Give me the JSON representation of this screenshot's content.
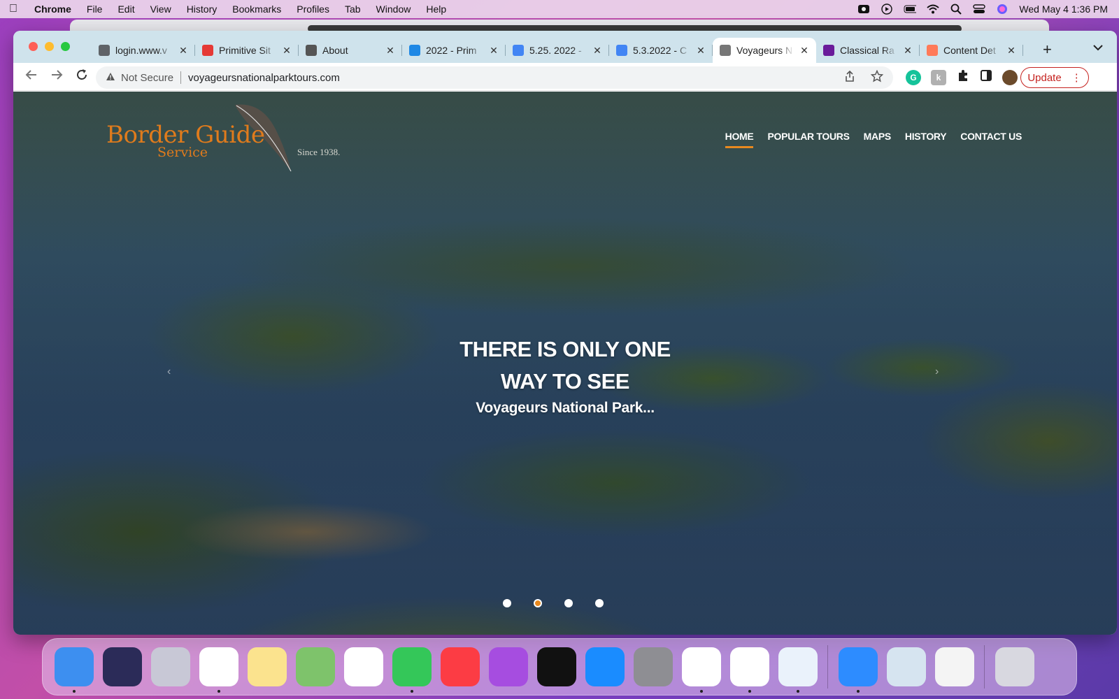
{
  "menubar": {
    "items": [
      "Chrome",
      "File",
      "Edit",
      "View",
      "History",
      "Bookmarks",
      "Profiles",
      "Tab",
      "Window",
      "Help"
    ],
    "clock": "Wed May 4  1:36 PM"
  },
  "tabs": [
    {
      "label": "login.www.v",
      "icon": "globe-icon",
      "color": "#5f6368"
    },
    {
      "label": "Primitive Sit",
      "icon": "primitive-icon",
      "color": "#e53935"
    },
    {
      "label": "About",
      "icon": "p-icon",
      "color": "#555555"
    },
    {
      "label": "2022 - Prim",
      "icon": "drive-icon",
      "color": "#1e88e5"
    },
    {
      "label": "5.25. 2022 -",
      "icon": "docs-icon",
      "color": "#4285f4"
    },
    {
      "label": "5.3.2022 - C",
      "icon": "docs-icon",
      "color": "#4285f4"
    },
    {
      "label": "Voyageurs N",
      "icon": "feather-icon",
      "color": "#777777",
      "active": true
    },
    {
      "label": "Classical Ra",
      "icon": "p-icon",
      "color": "#6a1b9a"
    },
    {
      "label": "Content Det",
      "icon": "hubspot-icon",
      "color": "#ff7a59"
    }
  ],
  "address": {
    "security": "Not Secure",
    "url": "voyageursnationalparktours.com"
  },
  "update_label": "Update",
  "site": {
    "logo": {
      "line1": "Border Guide",
      "line2": "Service",
      "since": "Since 1938."
    },
    "nav": [
      "HOME",
      "POPULAR TOURS",
      "MAPS",
      "HISTORY",
      "CONTACT US"
    ],
    "hero": {
      "line1": "THERE IS ONLY ONE",
      "line2": "WAY TO SEE",
      "line3": "Voyageurs National Park..."
    },
    "slider": {
      "count": 4,
      "active": 2
    }
  },
  "dock": [
    {
      "name": "finder-icon",
      "color": "#3d8ff0"
    },
    {
      "name": "siri-icon",
      "color": "#2b2b58"
    },
    {
      "name": "launchpad-icon",
      "color": "#c8c8d6"
    },
    {
      "name": "chrome-icon",
      "color": "#ffffff"
    },
    {
      "name": "notes-icon",
      "color": "#fbe38e"
    },
    {
      "name": "maps-icon",
      "color": "#7ec36b"
    },
    {
      "name": "photos-icon",
      "color": "#ffffff"
    },
    {
      "name": "messages-icon",
      "color": "#34c759"
    },
    {
      "name": "music-icon",
      "color": "#fc3c44"
    },
    {
      "name": "podcasts-icon",
      "color": "#a64de0"
    },
    {
      "name": "tv-icon",
      "color": "#111111"
    },
    {
      "name": "appstore-icon",
      "color": "#1a8cff"
    },
    {
      "name": "settings-icon",
      "color": "#8e8e93"
    },
    {
      "name": "slack-icon",
      "color": "#ffffff"
    },
    {
      "name": "clickup-icon",
      "color": "#ffffff"
    },
    {
      "name": "printer-icon",
      "color": "#eaf2fb"
    },
    {
      "name": "zoom-icon",
      "color": "#2d8cff"
    },
    {
      "name": "preview-icon",
      "color": "#d6e4f0"
    },
    {
      "name": "textedit-icon",
      "color": "#f4f4f4"
    },
    {
      "name": "trash-icon",
      "color": "#d8d8e0"
    }
  ]
}
